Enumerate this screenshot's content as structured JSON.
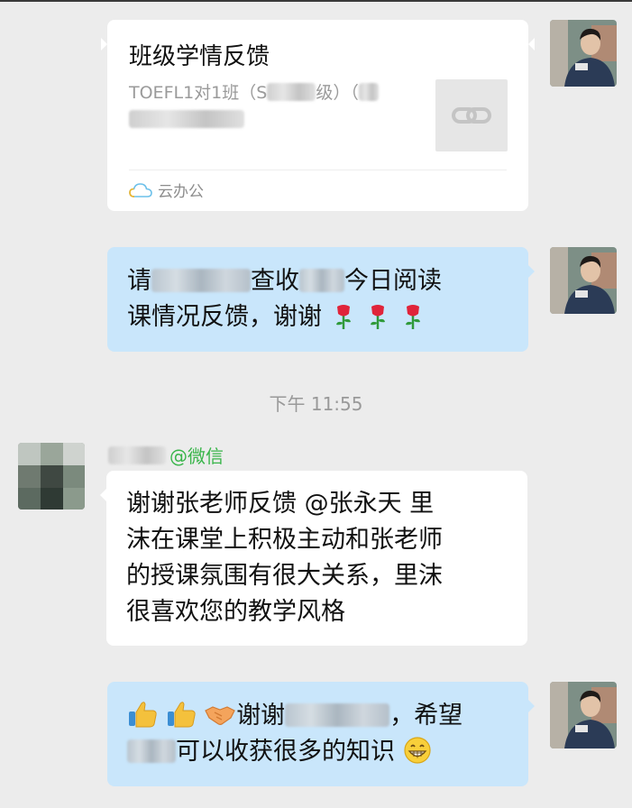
{
  "messages": {
    "card": {
      "title": "班级学情反馈",
      "desc_prefix": "TOEFL1对1班（S",
      "desc_mid": "级）（",
      "source": "云办公"
    },
    "msg2": {
      "part1": "请",
      "part2": "查收",
      "part3": "今日阅读",
      "line2": "课情况反馈，谢谢"
    },
    "timestamp": "下午 11:55",
    "msg3": {
      "sender_suffix": "@微信",
      "lines": [
        "谢谢张老师反馈 @张永天 里",
        "沫在课堂上积极主动和张老师",
        "的授课氛围有很大关系，里沫",
        "很喜欢您的教学风格"
      ]
    },
    "msg4": {
      "part1": "谢谢",
      "part2": "，希望",
      "line2": "可以收获很多的知识"
    }
  },
  "colors": {
    "background": "#ececec",
    "outgoing_bubble": "#c9e6fb",
    "incoming_bubble": "#ffffff",
    "wechat_green": "#39b54a"
  },
  "icons": [
    "link-icon",
    "cloud-icon",
    "rose-icon",
    "thumbs-up-icon",
    "handshake-icon",
    "grin-emoji-icon"
  ]
}
